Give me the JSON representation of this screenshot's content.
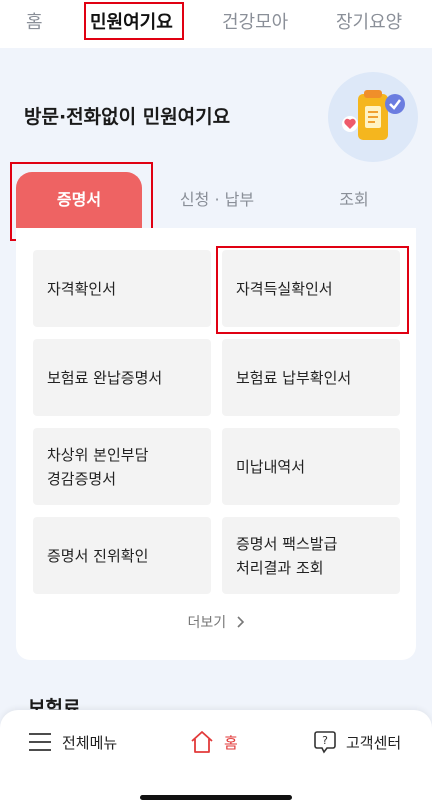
{
  "top_tabs": [
    {
      "label": "홈"
    },
    {
      "label": "민원여기요"
    },
    {
      "label": "건강모아"
    },
    {
      "label": "장기요양"
    }
  ],
  "hero": {
    "title": "방문·전화없이 민원여기요"
  },
  "service_tabs": [
    {
      "label": "증명서"
    },
    {
      "label": "신청 · 납부"
    },
    {
      "label": "조회"
    }
  ],
  "tiles": [
    {
      "label": "자격확인서"
    },
    {
      "label": "자격득실확인서"
    },
    {
      "label": "보험료 완납증명서"
    },
    {
      "label": "보험료 납부확인서"
    },
    {
      "label": "차상위 본인부담\n경감증명서"
    },
    {
      "label": "미납내역서"
    },
    {
      "label": "증명서 진위확인"
    },
    {
      "label": "증명서 팩스발급\n처리결과 조회"
    }
  ],
  "more": {
    "label": "더보기",
    "icon": "chevron-right-icon"
  },
  "next_section": {
    "title": "보험료"
  },
  "bottom_nav": [
    {
      "label": "전체메뉴",
      "icon": "menu-icon"
    },
    {
      "label": "홈",
      "icon": "home-icon"
    },
    {
      "label": "고객센터",
      "icon": "help-icon"
    }
  ],
  "colors": {
    "accent": "#ee6363",
    "highlight_box": "#e00012",
    "background": "#f0f4fb"
  }
}
